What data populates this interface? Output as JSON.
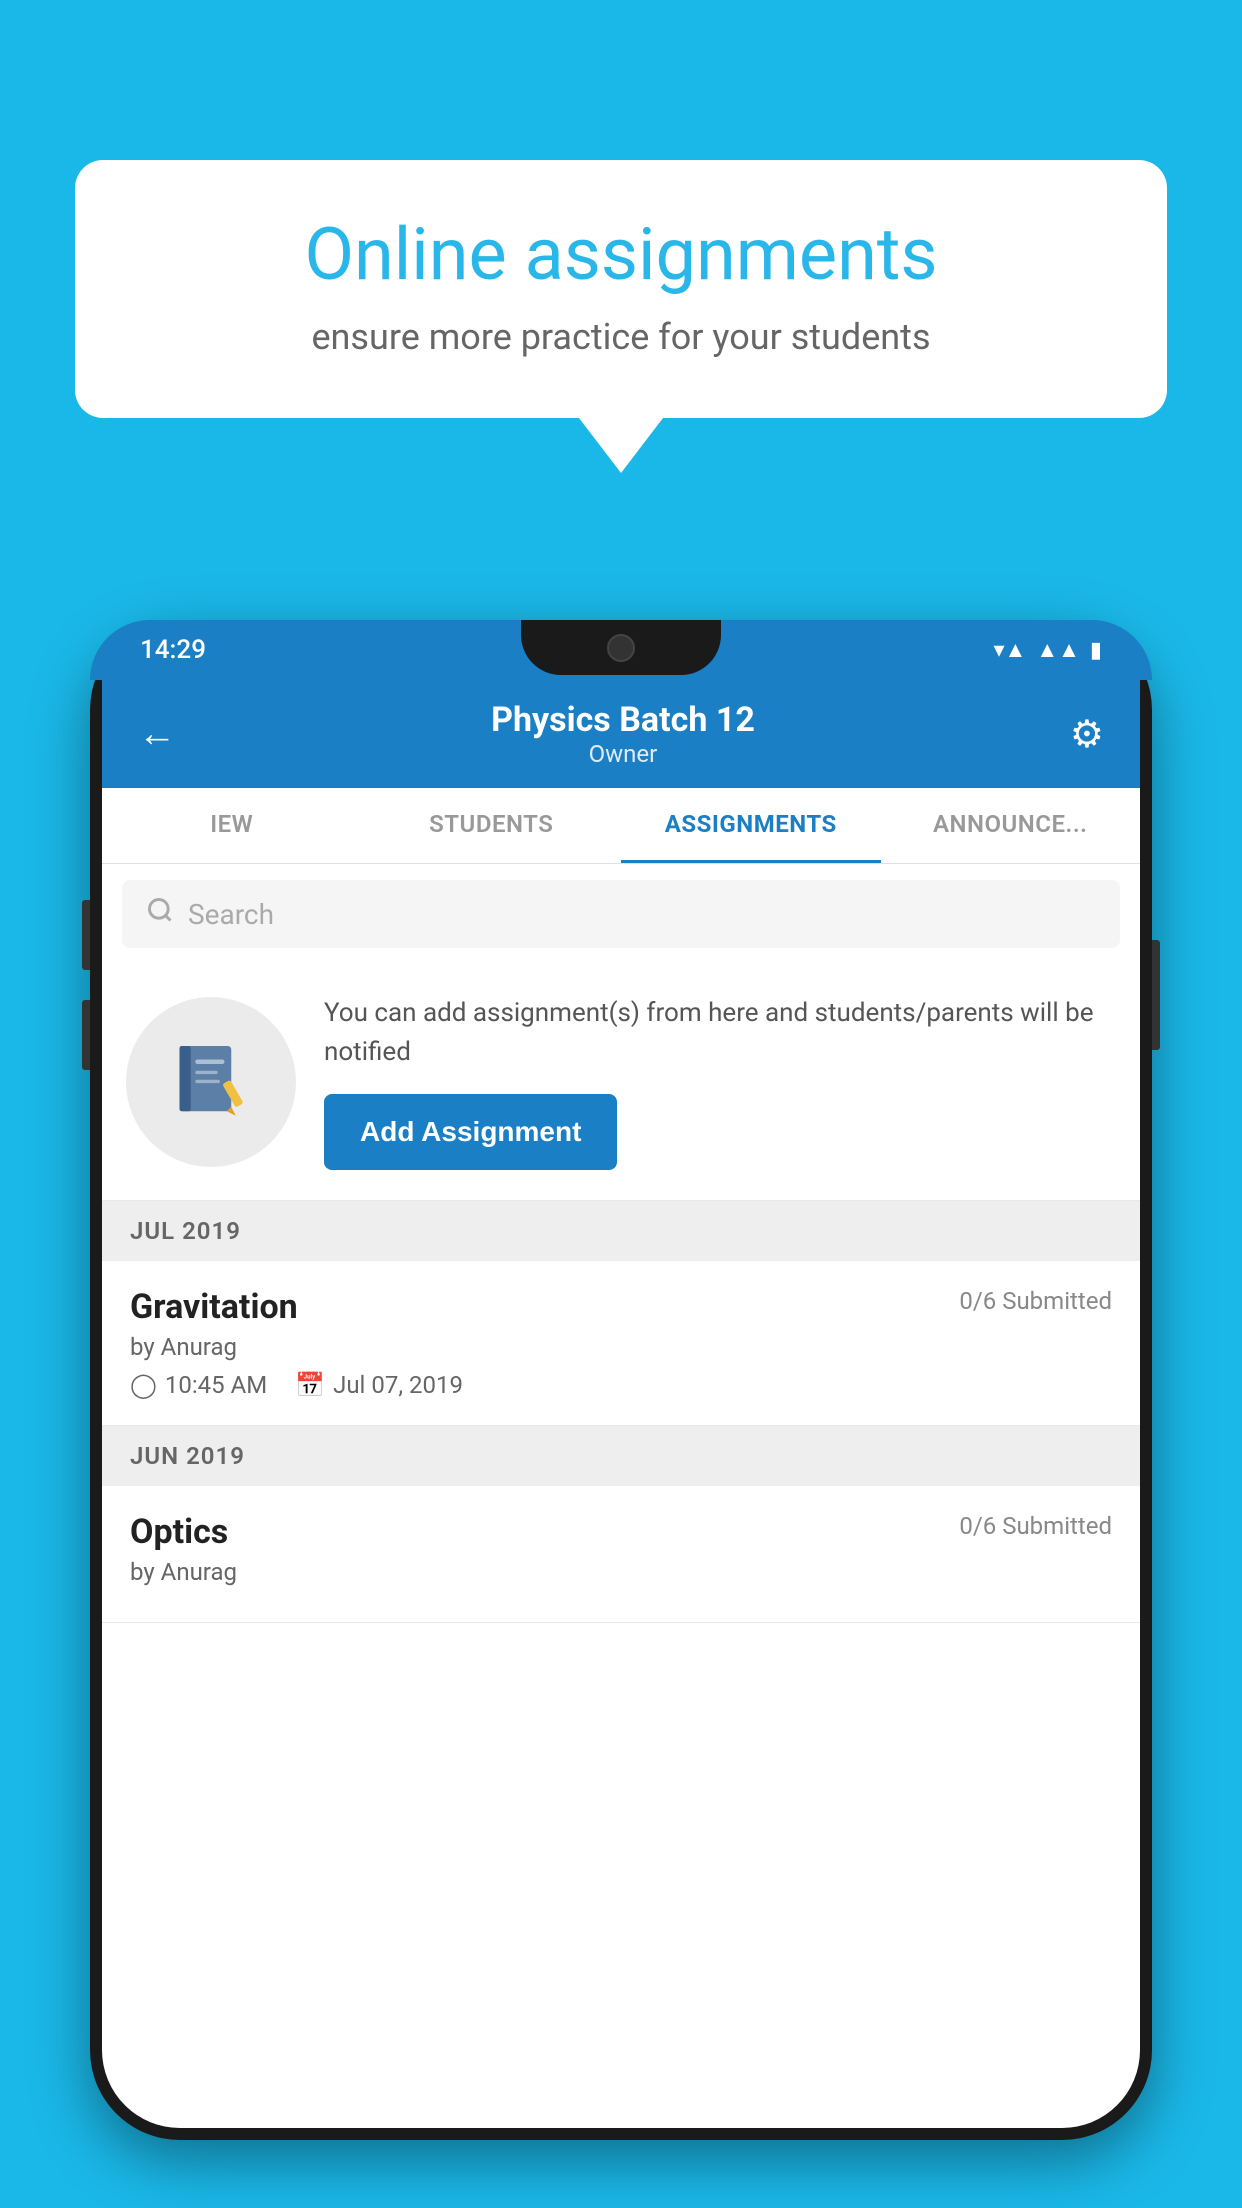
{
  "background_color": "#1ab8e8",
  "speech_bubble": {
    "title": "Online assignments",
    "subtitle": "ensure more practice for your students"
  },
  "phone": {
    "status_bar": {
      "time": "14:29",
      "wifi_icon": "wifi",
      "signal_icon": "signal",
      "battery_icon": "battery"
    },
    "header": {
      "title": "Physics Batch 12",
      "subtitle": "Owner",
      "back_icon": "back-arrow",
      "settings_icon": "gear"
    },
    "tabs": [
      {
        "label": "IEW",
        "active": false
      },
      {
        "label": "STUDENTS",
        "active": false
      },
      {
        "label": "ASSIGNMENTS",
        "active": true
      },
      {
        "label": "ANNOUNCEMENTS",
        "active": false
      }
    ],
    "search": {
      "placeholder": "Search"
    },
    "add_assignment_section": {
      "description": "You can add assignment(s) from here and students/parents will be notified",
      "button_label": "Add Assignment"
    },
    "assignment_groups": [
      {
        "month_label": "JUL 2019",
        "assignments": [
          {
            "name": "Gravitation",
            "submitted": "0/6 Submitted",
            "author": "by Anurag",
            "time": "10:45 AM",
            "date": "Jul 07, 2019"
          }
        ]
      },
      {
        "month_label": "JUN 2019",
        "assignments": [
          {
            "name": "Optics",
            "submitted": "0/6 Submitted",
            "author": "by Anurag",
            "time": "",
            "date": ""
          }
        ]
      }
    ]
  }
}
